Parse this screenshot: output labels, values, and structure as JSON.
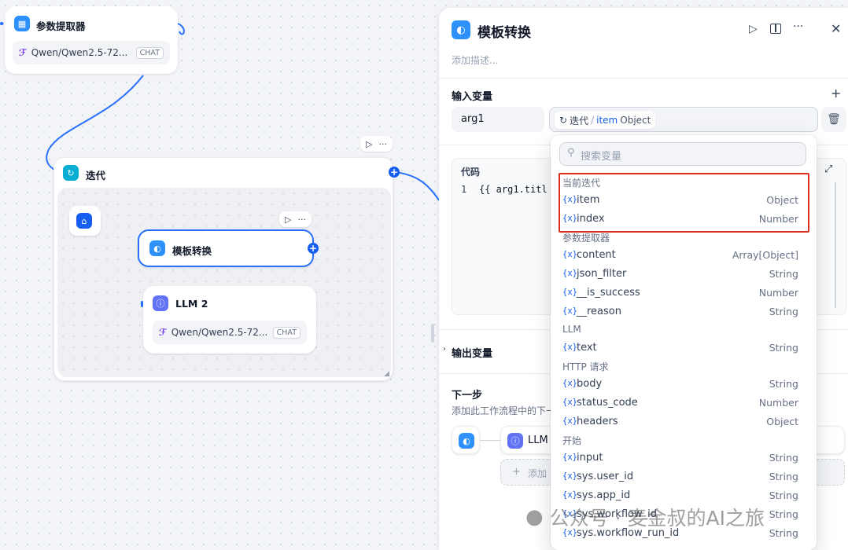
{
  "canvas": {
    "param_node": {
      "title": "参数提取器",
      "model": "Qwen/Qwen2.5-72...",
      "tag": "CHAT"
    },
    "iteration_node": {
      "title": "迭代",
      "toolbar_run": "▷",
      "toolbar_more": "···"
    },
    "template_node": {
      "title": "模板转换",
      "toolbar_run": "▷",
      "toolbar_more": "···"
    },
    "llm2_node": {
      "title": "LLM 2",
      "model": "Qwen/Qwen2.5-72...",
      "tag": "CHAT"
    }
  },
  "panel": {
    "title": "模板转换",
    "description_placeholder": "添加描述...",
    "input_vars_label": "输入变量",
    "arg_name": "arg1",
    "selector": {
      "source": "迭代",
      "sep": "/",
      "var": "item",
      "type": "Object"
    },
    "code_label": "代码",
    "code_line_no": "1",
    "code_text": "{{ arg1.titl",
    "output_vars_label": "输出变量",
    "next_step_label": "下一步",
    "next_step_desc": "添加此工作流程中的下一",
    "next_node_label": "LLM",
    "add_next_label": "添加",
    "colors": {
      "accent": "#155eef",
      "highlight": "#d92d20"
    }
  },
  "dropdown": {
    "search_placeholder": "搜索变量",
    "var_prefix": "{x}",
    "groups": [
      {
        "title": "当前迭代",
        "vars": [
          {
            "name": "item",
            "type": "Object"
          },
          {
            "name": "index",
            "type": "Number"
          }
        ]
      },
      {
        "title": "参数提取器",
        "vars": [
          {
            "name": "content",
            "type": "Array[Object]"
          },
          {
            "name": "json_filter",
            "type": "String"
          },
          {
            "name": "__is_success",
            "type": "Number"
          },
          {
            "name": "__reason",
            "type": "String"
          }
        ]
      },
      {
        "title": "LLM",
        "vars": [
          {
            "name": "text",
            "type": "String"
          }
        ]
      },
      {
        "title": "HTTP 请求",
        "vars": [
          {
            "name": "body",
            "type": "String"
          },
          {
            "name": "status_code",
            "type": "Number"
          },
          {
            "name": "headers",
            "type": "Object"
          }
        ]
      },
      {
        "title": "开始",
        "vars": [
          {
            "name": "input",
            "type": "String"
          },
          {
            "name": "sys.user_id",
            "type": "String"
          },
          {
            "name": "sys.app_id",
            "type": "String"
          },
          {
            "name": "sys.workflow_id",
            "type": "String"
          },
          {
            "name": "sys.workflow_run_id",
            "type": "String"
          }
        ]
      }
    ]
  },
  "watermark": "公众号 · 麦金叔的AI之旅"
}
